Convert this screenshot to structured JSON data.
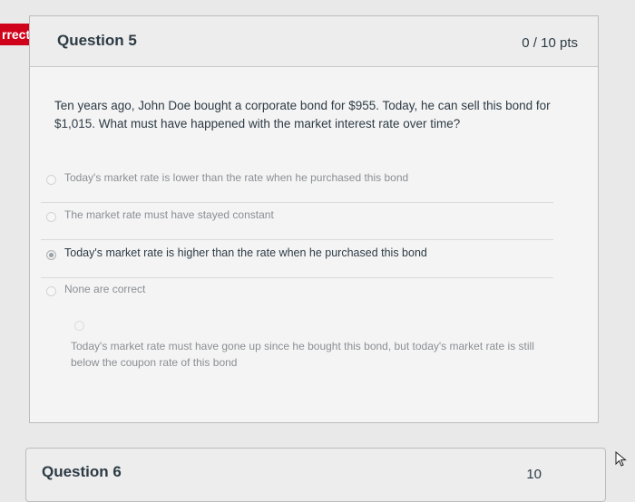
{
  "status_badge": "rrect",
  "question": {
    "title": "Question 5",
    "points": "0 / 10 pts",
    "text": "Ten years ago, John Doe bought a corporate bond for $955. Today, he can sell this bond for $1,015. What must have happened with the market interest rate over time?"
  },
  "answers": [
    {
      "label": "Today's market rate is lower than the rate when he purchased this bond",
      "selected": false
    },
    {
      "label": "The market rate must have stayed constant",
      "selected": false
    },
    {
      "label": "Today's market rate is higher than the rate when he purchased this bond",
      "selected": true
    },
    {
      "label": "None are correct",
      "selected": false
    }
  ],
  "written_answer": "Today's market rate must have gone up since he bought this bond, but today's market rate is still below the coupon rate of this bond",
  "next_question": {
    "title": "Question 6",
    "points": "10"
  },
  "icons": {
    "cursor": "pointer-cursor-icon"
  }
}
